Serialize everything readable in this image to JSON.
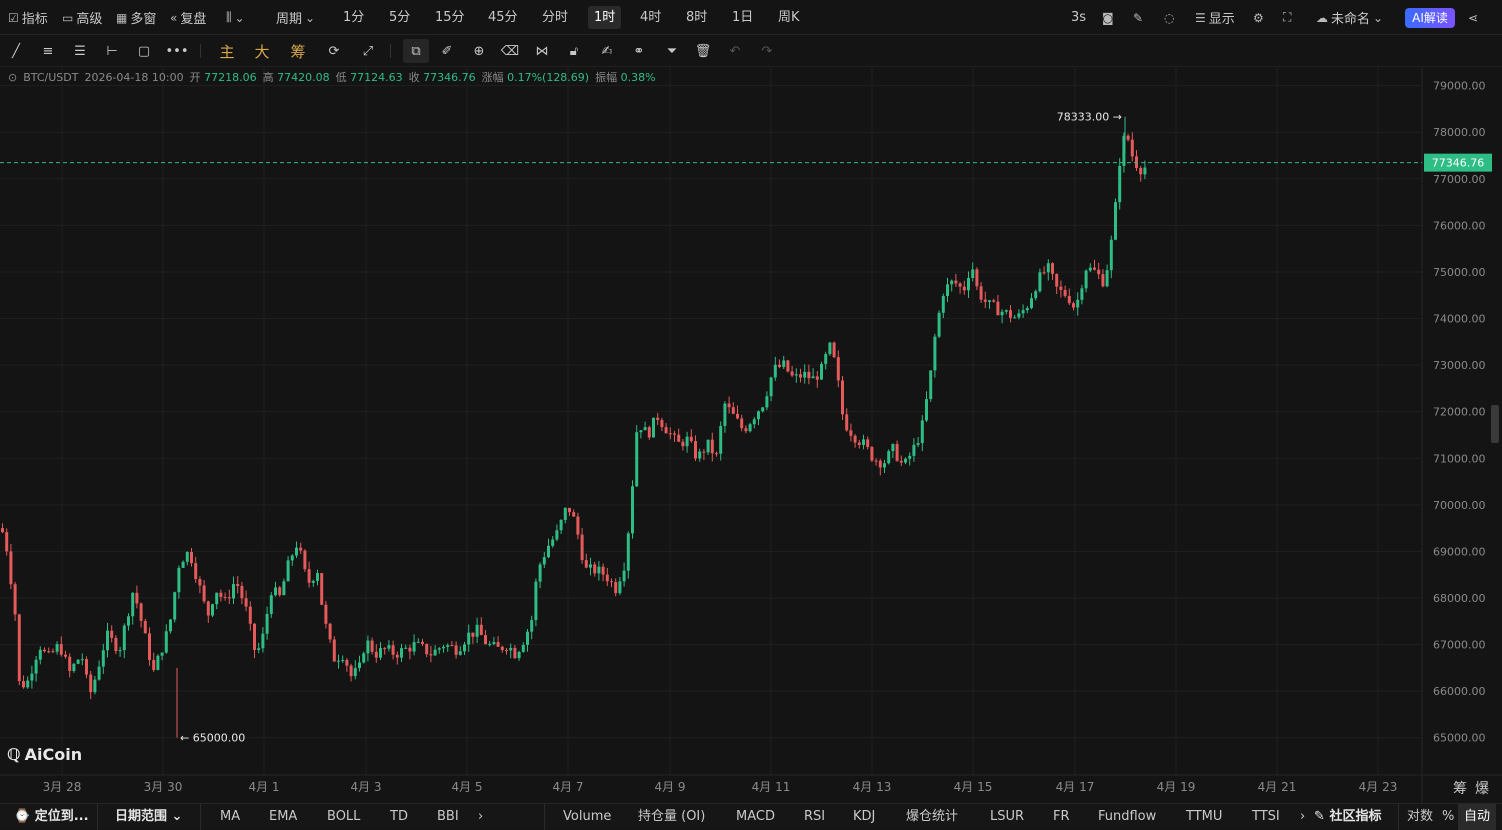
{
  "topbar": {
    "indicators": "指标",
    "advanced": "高级",
    "multi_window": "多窗",
    "replay": "复盘",
    "period_label": "周期",
    "periods": [
      "1分",
      "5分",
      "15分",
      "45分",
      "分时",
      "1时",
      "4时",
      "8时",
      "1日",
      "周K"
    ],
    "active_period": "1时",
    "refresh": "3s",
    "display": "显示",
    "layout_name": "未命名",
    "ai_button": "AI解读"
  },
  "drawbar": {
    "main": "主",
    "big": "大",
    "chips": "筹"
  },
  "info": {
    "pair": "BTC/USDT",
    "datetime": "2026-04-18 10:00",
    "open_label": "开",
    "open": "77218.06",
    "high_label": "高",
    "high": "77420.08",
    "low_label": "低",
    "low": "77124.63",
    "close_label": "收",
    "close": "77346.76",
    "change_label": "涨幅",
    "change": "0.17%(128.69)",
    "amp_label": "振幅",
    "amp": "0.38%"
  },
  "colors": {
    "up": "#2ebd85",
    "down": "#e55a5a",
    "price_line": "#2ebd85",
    "background": "#141414",
    "grid": "#1f1f1f"
  },
  "chart_data": {
    "type": "candlestick",
    "y_ticks": [
      "79000.00",
      "78000.00",
      "77000.00",
      "76000.00",
      "75000.00",
      "74000.00",
      "73000.00",
      "72000.00",
      "71000.00",
      "70000.00",
      "69000.00",
      "68000.00",
      "67000.00",
      "66000.00",
      "65000.00"
    ],
    "x_ticks": [
      "3月 28",
      "3月 30",
      "4月 1",
      "4月 3",
      "4月 5",
      "4月 7",
      "4月 9",
      "4月 11",
      "4月 13",
      "4月 15",
      "4月 17",
      "4月 19",
      "4月 21",
      "4月 23"
    ],
    "ylim": [
      64200,
      79400
    ],
    "current_price": "77346.76",
    "max_label": "78333.00 →",
    "min_label": "← 65000.00",
    "close_path": [
      [
        0,
        69500
      ],
      [
        6,
        69000
      ],
      [
        14,
        67600
      ],
      [
        18,
        66100
      ],
      [
        26,
        66200
      ],
      [
        38,
        67000
      ],
      [
        46,
        66700
      ],
      [
        58,
        67000
      ],
      [
        68,
        66400
      ],
      [
        80,
        66800
      ],
      [
        88,
        65900
      ],
      [
        94,
        66300
      ],
      [
        105,
        67200
      ],
      [
        118,
        66900
      ],
      [
        132,
        68200
      ],
      [
        142,
        67300
      ],
      [
        152,
        66400
      ],
      [
        168,
        67400
      ],
      [
        178,
        68800
      ],
      [
        188,
        69000
      ],
      [
        196,
        68400
      ],
      [
        206,
        67600
      ],
      [
        214,
        68200
      ],
      [
        224,
        67900
      ],
      [
        234,
        68400
      ],
      [
        244,
        67800
      ],
      [
        254,
        66800
      ],
      [
        260,
        67000
      ],
      [
        270,
        68200
      ],
      [
        278,
        68000
      ],
      [
        288,
        68800
      ],
      [
        296,
        69200
      ],
      [
        306,
        68300
      ],
      [
        316,
        68600
      ],
      [
        322,
        67600
      ],
      [
        332,
        66700
      ],
      [
        342,
        66800
      ],
      [
        350,
        66300
      ],
      [
        358,
        66500
      ],
      [
        364,
        67100
      ],
      [
        374,
        66800
      ],
      [
        384,
        66900
      ],
      [
        394,
        66800
      ],
      [
        404,
        66900
      ],
      [
        414,
        67000
      ],
      [
        430,
        66800
      ],
      [
        442,
        67000
      ],
      [
        456,
        66900
      ],
      [
        466,
        67200
      ],
      [
        476,
        67300
      ],
      [
        486,
        67000
      ],
      [
        496,
        66900
      ],
      [
        506,
        67000
      ],
      [
        514,
        66800
      ],
      [
        522,
        67100
      ],
      [
        530,
        67500
      ],
      [
        536,
        68600
      ],
      [
        546,
        69100
      ],
      [
        556,
        69400
      ],
      [
        566,
        70000
      ],
      [
        574,
        69600
      ],
      [
        584,
        68600
      ],
      [
        594,
        68600
      ],
      [
        604,
        68500
      ],
      [
        614,
        68200
      ],
      [
        624,
        68800
      ],
      [
        630,
        70200
      ],
      [
        636,
        71800
      ],
      [
        646,
        71500
      ],
      [
        656,
        71900
      ],
      [
        666,
        71600
      ],
      [
        676,
        71300
      ],
      [
        686,
        71400
      ],
      [
        696,
        71000
      ],
      [
        706,
        71300
      ],
      [
        716,
        71000
      ],
      [
        722,
        72200
      ],
      [
        732,
        71900
      ],
      [
        742,
        71600
      ],
      [
        752,
        71900
      ],
      [
        762,
        72200
      ],
      [
        772,
        72900
      ],
      [
        782,
        73000
      ],
      [
        792,
        72700
      ],
      [
        802,
        72800
      ],
      [
        812,
        72700
      ],
      [
        820,
        72900
      ],
      [
        828,
        73400
      ],
      [
        834,
        73000
      ],
      [
        842,
        71800
      ],
      [
        852,
        71500
      ],
      [
        862,
        71300
      ],
      [
        872,
        71000
      ],
      [
        882,
        70900
      ],
      [
        892,
        71200
      ],
      [
        902,
        70800
      ],
      [
        912,
        71200
      ],
      [
        920,
        71600
      ],
      [
        928,
        72600
      ],
      [
        934,
        73700
      ],
      [
        942,
        74600
      ],
      [
        952,
        74800
      ],
      [
        962,
        74600
      ],
      [
        970,
        75200
      ],
      [
        976,
        74600
      ],
      [
        986,
        74300
      ],
      [
        996,
        74200
      ],
      [
        1006,
        74100
      ],
      [
        1016,
        74000
      ],
      [
        1026,
        74300
      ],
      [
        1036,
        74800
      ],
      [
        1046,
        75100
      ],
      [
        1056,
        74600
      ],
      [
        1066,
        74500
      ],
      [
        1074,
        74200
      ],
      [
        1084,
        75100
      ],
      [
        1094,
        75000
      ],
      [
        1102,
        74800
      ],
      [
        1108,
        75300
      ],
      [
        1114,
        76400
      ],
      [
        1120,
        77800
      ],
      [
        1126,
        77900
      ],
      [
        1132,
        77400
      ],
      [
        1140,
        77200
      ],
      [
        1147,
        77300
      ]
    ]
  },
  "bottombar": {
    "locate": "定位到...",
    "date_range": "日期范围",
    "main_indicators": [
      "MA",
      "EMA",
      "BOLL",
      "TD",
      "BBI"
    ],
    "sub_indicators": [
      "Volume",
      "持仓量 (OI)",
      "MACD",
      "RSI",
      "KDJ",
      "爆仓统计",
      "LSUR",
      "FR",
      "Fundflow",
      "TTMU",
      "TTSI"
    ],
    "community": "社区指标",
    "log": "对数",
    "percent": "%",
    "auto": "自动"
  },
  "corner": {
    "chips": "筹",
    "liquidation": "爆"
  },
  "logo_text": "AiCoin"
}
